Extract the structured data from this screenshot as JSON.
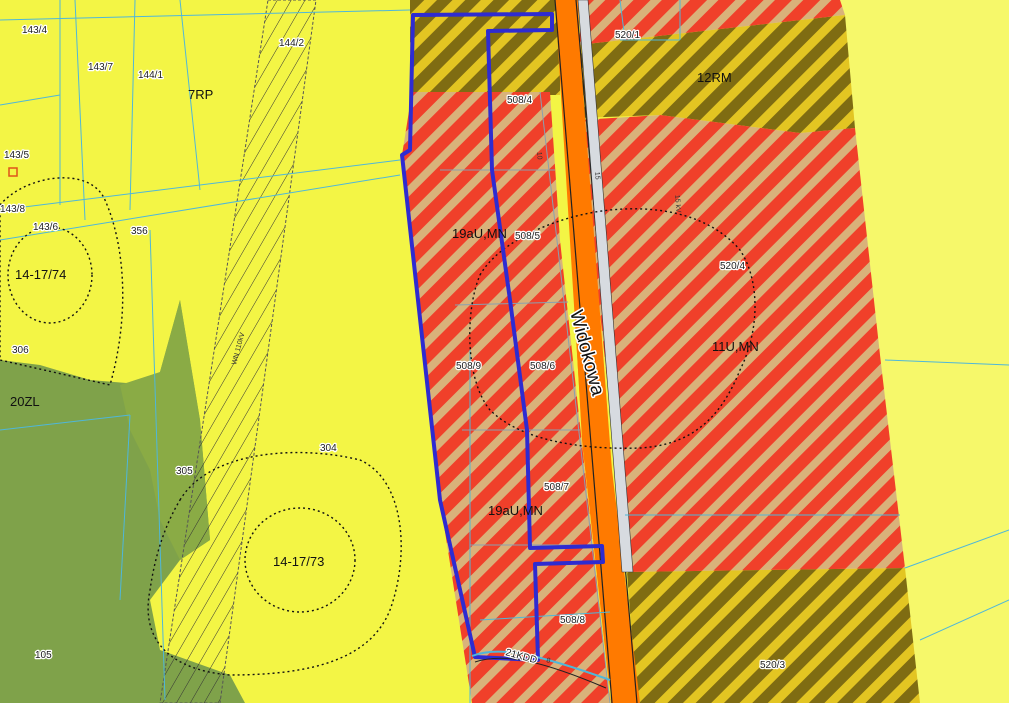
{
  "map": {
    "colors": {
      "agricultural_yellow": "#f3f545",
      "forest_green": "#7fa24a",
      "forest_light": "#9dbb3a",
      "residential_red": "#f0402a",
      "residential_hatch": "#d9b27a",
      "rm_olive": "#8b7a10",
      "rm_hatch": "#e0c020",
      "road_orange": "#ff7a00",
      "road_gray": "#d7dbe0",
      "boundary_blue": "#2e2bd1",
      "parcel_line": "#4fb7d9"
    },
    "road_name": "Widokowa",
    "zones": {
      "z7rp": "7RP",
      "z12rm": "12RM",
      "z19a": "19aU,MN",
      "z19b": "19aU,MN",
      "z11": "11U,MN",
      "z20zl": "20ZL",
      "c74": "14-17/74",
      "c73": "14-17/73"
    },
    "parcels": {
      "p1434": "143/4",
      "p1437": "143/7",
      "p1441": "144/1",
      "p1442": "144/2",
      "p1435": "143/5",
      "p1438": "143/8",
      "p1436": "143/6",
      "p356": "356",
      "p306": "306",
      "p305": "305",
      "p304": "304",
      "p105": "105",
      "p5201": "520/1",
      "p5084": "508/4",
      "p5085": "508/5",
      "p5204": "520/4",
      "p5089": "508/9",
      "p5086": "508/6",
      "p5087": "508/7",
      "p5088": "508/8",
      "p5203": "520/3"
    },
    "small_labels": {
      "wn": "WN 110kV",
      "kv": "15 kV",
      "n10": "10",
      "n15": "15",
      "n8": "8"
    },
    "lane_label": "21KDD"
  }
}
